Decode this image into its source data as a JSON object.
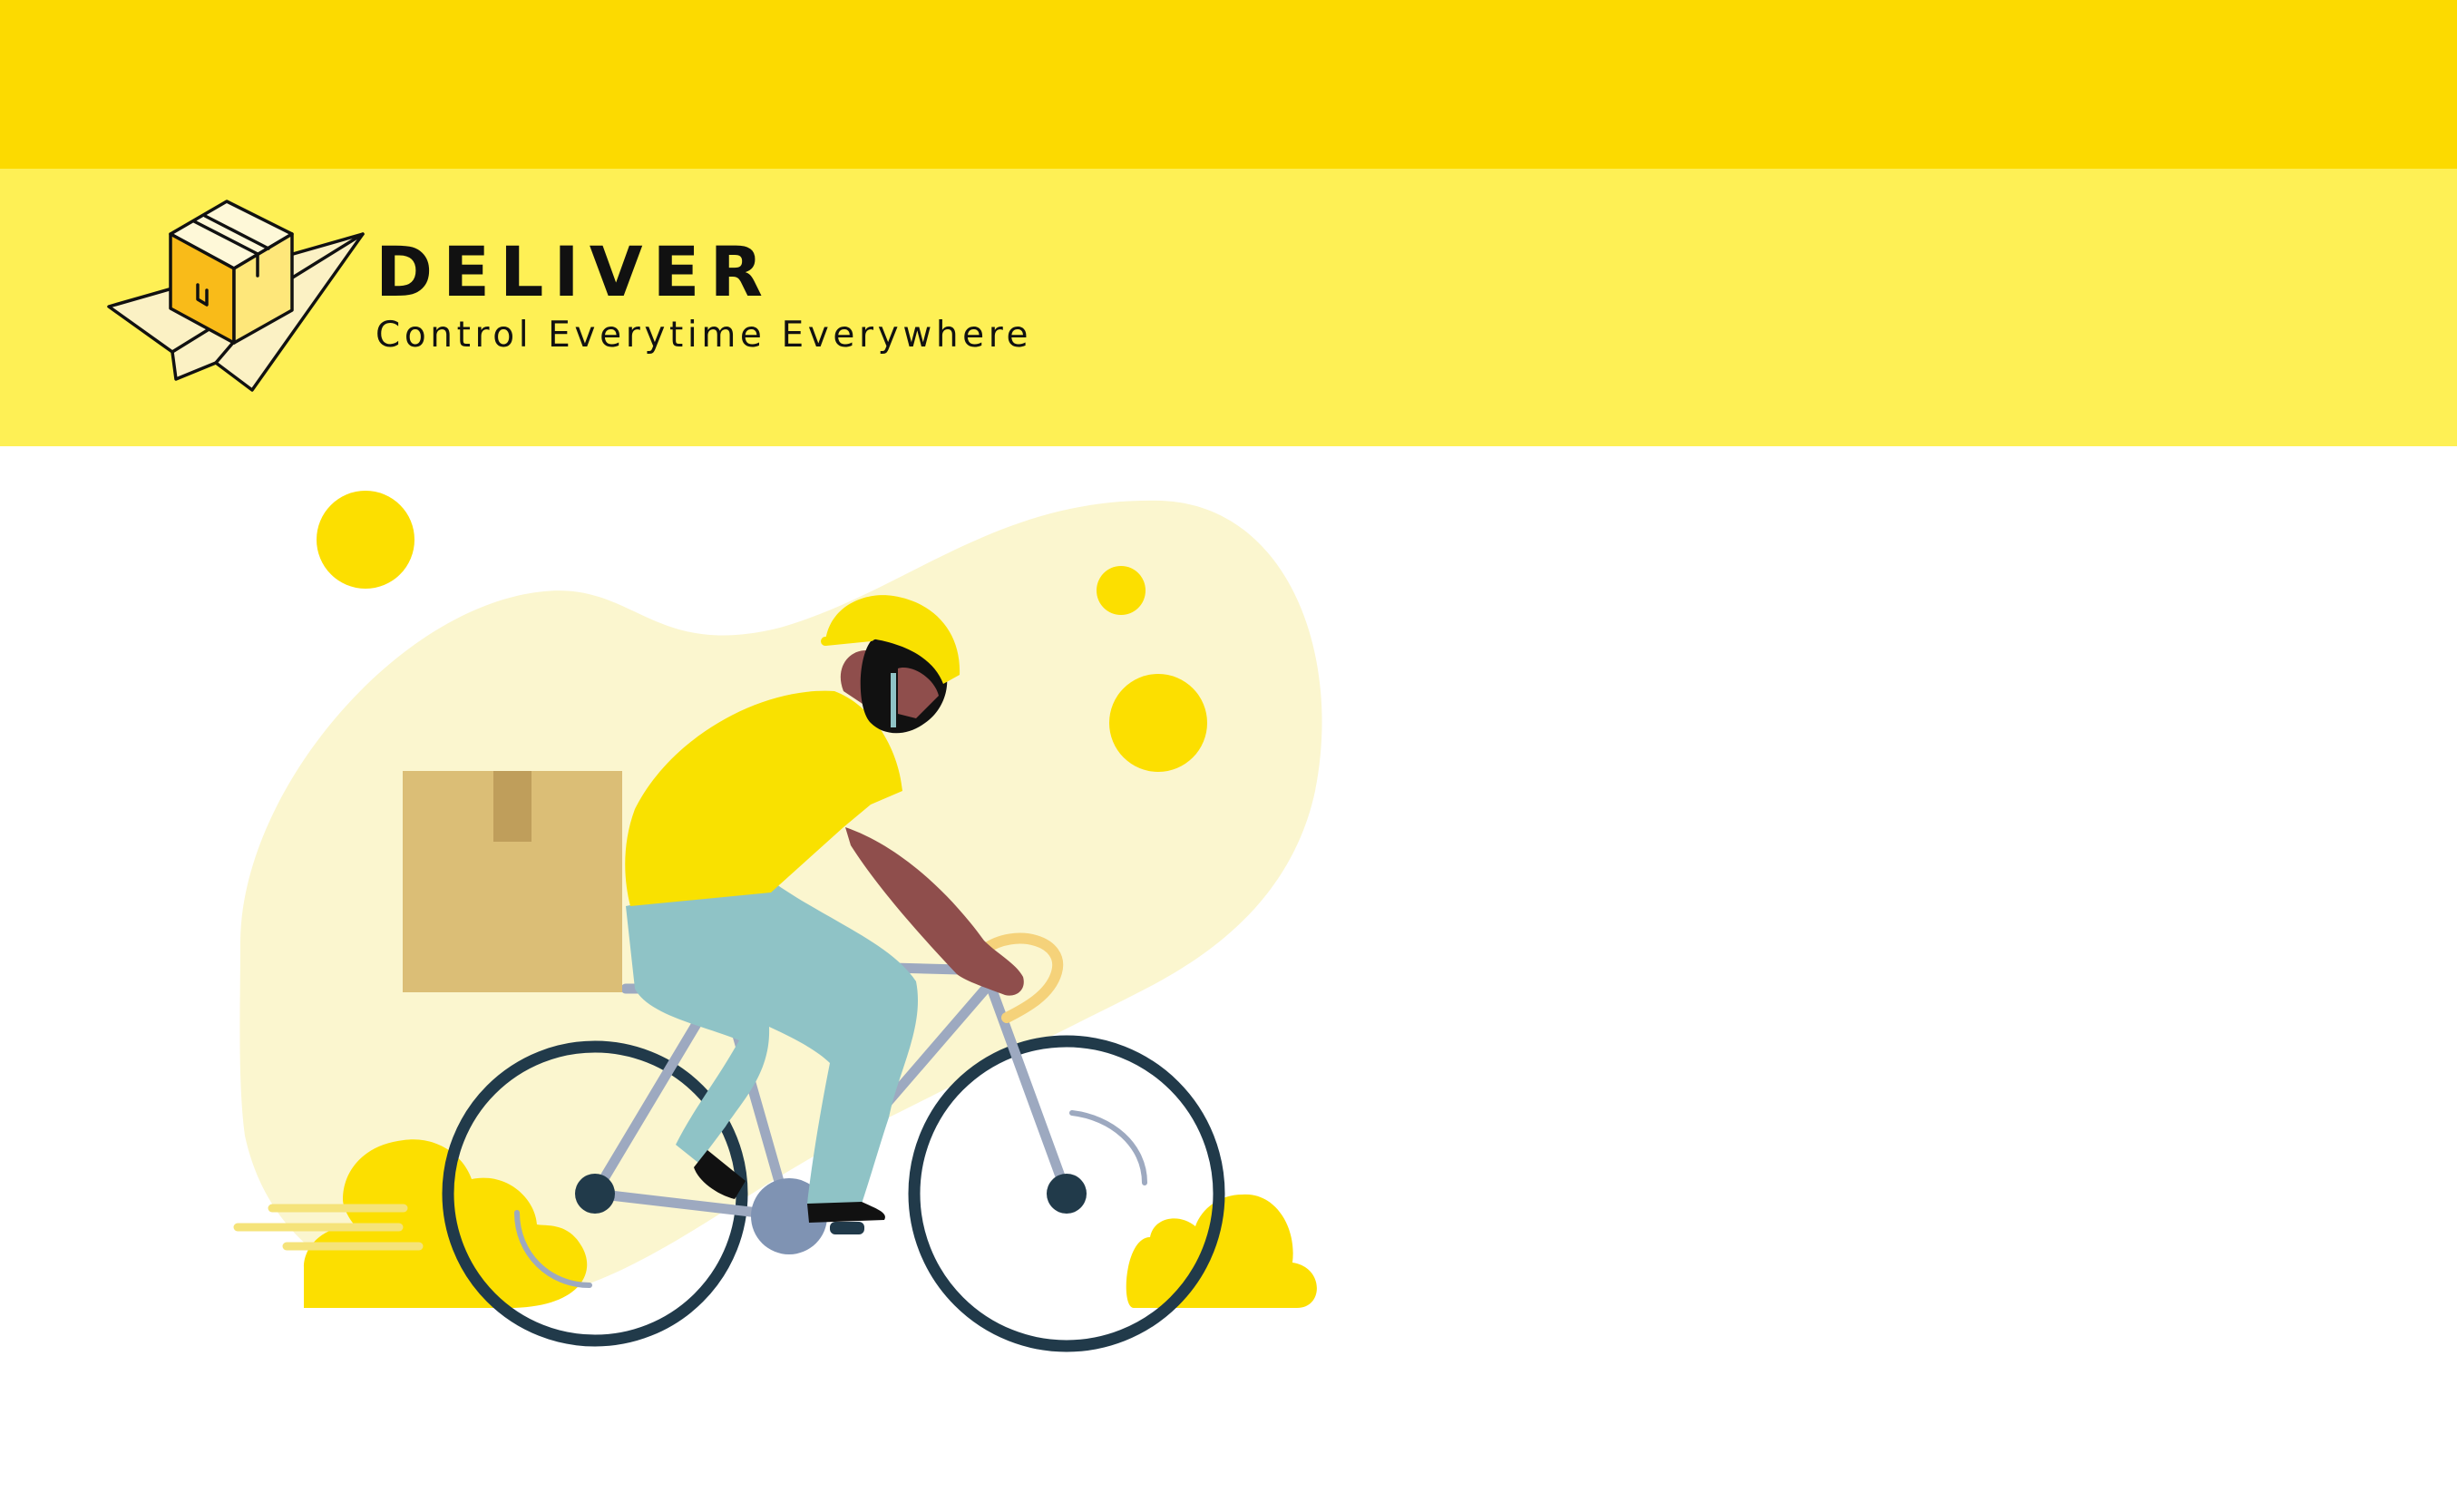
{
  "brand": {
    "name": "DELIVER",
    "tagline": "Control Everytime Everywhere",
    "logo_icon": "package-paper-plane-icon"
  },
  "illustration": {
    "subject": "courier-on-bicycle-illustration"
  },
  "colors": {
    "top_strip": "#FCDA00",
    "header_band": "#FEF055",
    "accent_yellow": "#FCDF00",
    "blob": "#FBF6CF",
    "box": "#DBBE76",
    "box_tape": "#BF9E5B",
    "shirt": "#F9E100",
    "pants": "#8FC3C6",
    "skin": "#8F4E4C",
    "wheel": "#213A4A",
    "frame": "#9DA9C0",
    "text": "#111111",
    "background": "#FFFFFF"
  }
}
